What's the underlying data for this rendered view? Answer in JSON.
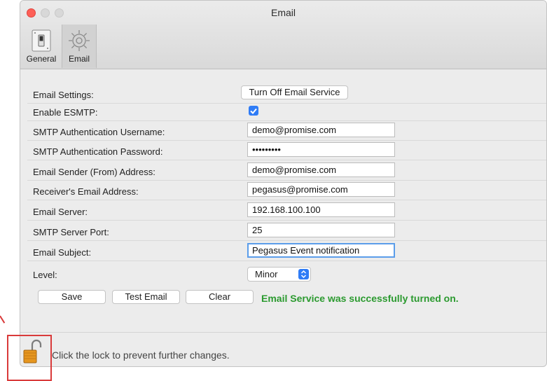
{
  "window": {
    "title": "Email"
  },
  "toolbar": {
    "general_label": "General",
    "email_label": "Email"
  },
  "form": {
    "email_settings_label": "Email Settings:",
    "turn_off_button": "Turn Off Email Service",
    "enable_esmtp_label": "Enable ESMTP:",
    "enable_esmtp_checked": true,
    "smtp_user_label": "SMTP Authentication Username:",
    "smtp_user_value": "demo@promise.com",
    "smtp_pass_label": "SMTP Authentication Password:",
    "smtp_pass_value": "•••••••••",
    "sender_label": "Email Sender (From) Address:",
    "sender_value": "demo@promise.com",
    "receiver_label": "Receiver's Email Address:",
    "receiver_value": "pegasus@promise.com",
    "server_label": "Email Server:",
    "server_value": "192.168.100.100",
    "port_label": "SMTP Server Port:",
    "port_value": "25",
    "subject_label": "Email Subject:",
    "subject_value": "Pegasus Event notification",
    "level_label": "Level:",
    "level_value": "Minor"
  },
  "actions": {
    "save_label": "Save",
    "test_label": "Test Email",
    "clear_label": "Clear",
    "status_message": "Email Service was successfully turned on."
  },
  "footer": {
    "lock_text": "Click the lock to prevent further changes."
  },
  "colors": {
    "accent": "#2f7cf6",
    "success": "#2b9a2f",
    "annotation": "#d93a3a",
    "close": "#fd5f57"
  }
}
